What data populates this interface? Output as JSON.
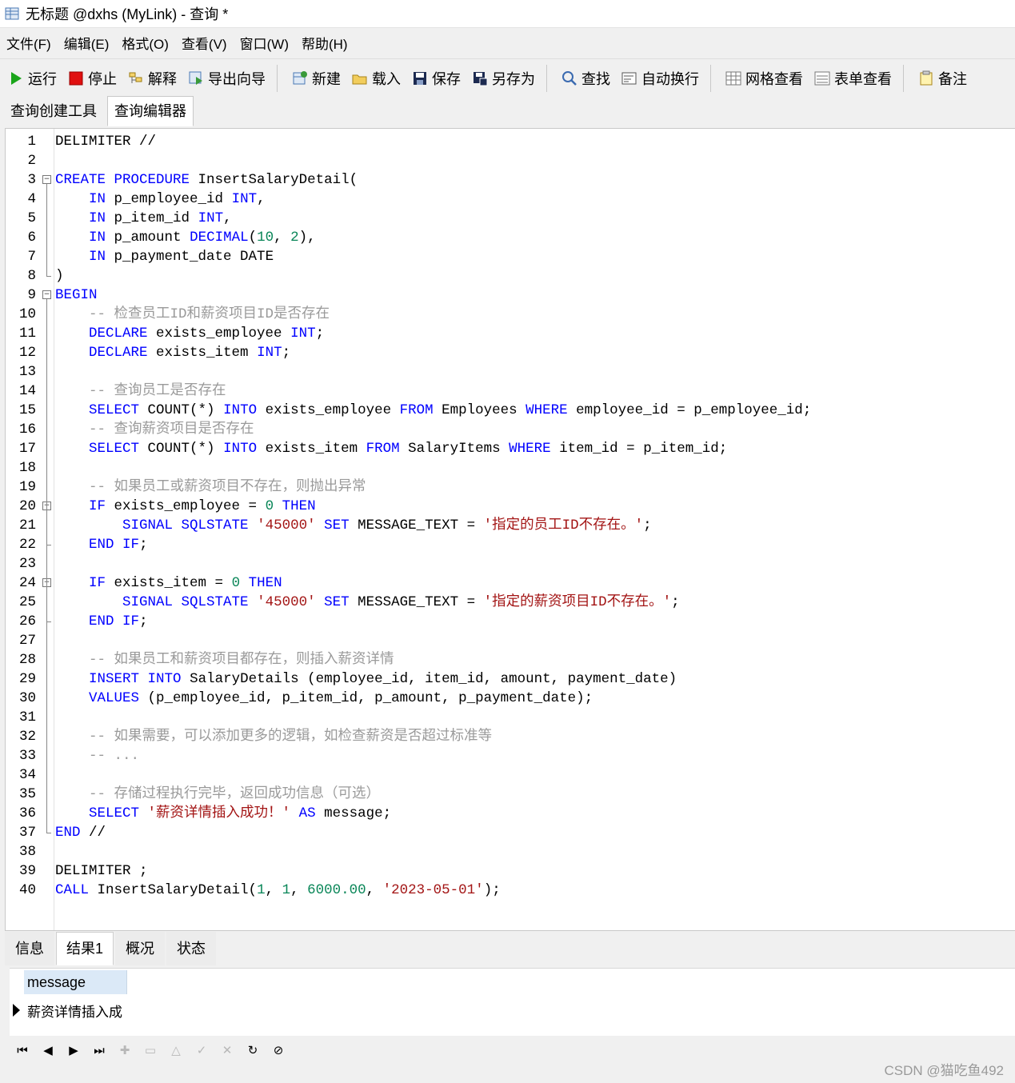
{
  "window": {
    "title": "无标题 @dxhs (MyLink) - 查询 *"
  },
  "menu": [
    "文件(F)",
    "编辑(E)",
    "格式(O)",
    "查看(V)",
    "窗口(W)",
    "帮助(H)"
  ],
  "toolbar": [
    {
      "label": "运行",
      "icon": "run-icon"
    },
    {
      "label": "停止",
      "icon": "stop-icon"
    },
    {
      "label": "解释",
      "icon": "explain-icon"
    },
    {
      "label": "导出向导",
      "icon": "export-wizard-icon"
    },
    {
      "label": "新建",
      "icon": "new-icon"
    },
    {
      "label": "载入",
      "icon": "load-icon"
    },
    {
      "label": "保存",
      "icon": "save-icon"
    },
    {
      "label": "另存为",
      "icon": "save-as-icon"
    },
    {
      "label": "查找",
      "icon": "find-icon"
    },
    {
      "label": "自动换行",
      "icon": "word-wrap-icon"
    },
    {
      "label": "网格查看",
      "icon": "grid-view-icon"
    },
    {
      "label": "表单查看",
      "icon": "form-view-icon"
    },
    {
      "label": "备注",
      "icon": "note-icon"
    }
  ],
  "doc_tabs": [
    "查询创建工具",
    "查询编辑器"
  ],
  "active_doc_tab": "查询编辑器",
  "code_lines": [
    [
      {
        "t": "DELIMITER //",
        "c": "id"
      }
    ],
    [],
    [
      {
        "t": "CREATE",
        "c": "kw"
      },
      {
        "t": " ",
        "c": "id"
      },
      {
        "t": "PROCEDURE",
        "c": "kw"
      },
      {
        "t": " InsertSalaryDetail(",
        "c": "id"
      }
    ],
    [
      {
        "t": "    ",
        "c": "id"
      },
      {
        "t": "IN",
        "c": "kw"
      },
      {
        "t": " p_employee_id ",
        "c": "id"
      },
      {
        "t": "INT",
        "c": "kw"
      },
      {
        "t": ",",
        "c": "id"
      }
    ],
    [
      {
        "t": "    ",
        "c": "id"
      },
      {
        "t": "IN",
        "c": "kw"
      },
      {
        "t": " p_item_id ",
        "c": "id"
      },
      {
        "t": "INT",
        "c": "kw"
      },
      {
        "t": ",",
        "c": "id"
      }
    ],
    [
      {
        "t": "    ",
        "c": "id"
      },
      {
        "t": "IN",
        "c": "kw"
      },
      {
        "t": " p_amount ",
        "c": "id"
      },
      {
        "t": "DECIMAL",
        "c": "kw"
      },
      {
        "t": "(",
        "c": "id"
      },
      {
        "t": "10",
        "c": "num"
      },
      {
        "t": ", ",
        "c": "id"
      },
      {
        "t": "2",
        "c": "num"
      },
      {
        "t": "),",
        "c": "id"
      }
    ],
    [
      {
        "t": "    ",
        "c": "id"
      },
      {
        "t": "IN",
        "c": "kw"
      },
      {
        "t": " p_payment_date DATE",
        "c": "id"
      }
    ],
    [
      {
        "t": ")",
        "c": "id"
      }
    ],
    [
      {
        "t": "BEGIN",
        "c": "kw"
      }
    ],
    [
      {
        "t": "    -- 检查员工ID和薪资项目ID是否存在",
        "c": "cm"
      }
    ],
    [
      {
        "t": "    ",
        "c": "id"
      },
      {
        "t": "DECLARE",
        "c": "kw"
      },
      {
        "t": " exists_employee ",
        "c": "id"
      },
      {
        "t": "INT",
        "c": "kw"
      },
      {
        "t": ";",
        "c": "id"
      }
    ],
    [
      {
        "t": "    ",
        "c": "id"
      },
      {
        "t": "DECLARE",
        "c": "kw"
      },
      {
        "t": " exists_item ",
        "c": "id"
      },
      {
        "t": "INT",
        "c": "kw"
      },
      {
        "t": ";",
        "c": "id"
      }
    ],
    [],
    [
      {
        "t": "    -- 查询员工是否存在",
        "c": "cm"
      }
    ],
    [
      {
        "t": "    ",
        "c": "id"
      },
      {
        "t": "SELECT",
        "c": "kw"
      },
      {
        "t": " COUNT(*) ",
        "c": "id"
      },
      {
        "t": "INTO",
        "c": "kw"
      },
      {
        "t": " exists_employee ",
        "c": "id"
      },
      {
        "t": "FROM",
        "c": "kw"
      },
      {
        "t": " Employees ",
        "c": "id"
      },
      {
        "t": "WHERE",
        "c": "kw"
      },
      {
        "t": " employee_id = p_employee_id;",
        "c": "id"
      }
    ],
    [
      {
        "t": "    -- 查询薪资项目是否存在",
        "c": "cm"
      }
    ],
    [
      {
        "t": "    ",
        "c": "id"
      },
      {
        "t": "SELECT",
        "c": "kw"
      },
      {
        "t": " COUNT(*) ",
        "c": "id"
      },
      {
        "t": "INTO",
        "c": "kw"
      },
      {
        "t": " exists_item ",
        "c": "id"
      },
      {
        "t": "FROM",
        "c": "kw"
      },
      {
        "t": " SalaryItems ",
        "c": "id"
      },
      {
        "t": "WHERE",
        "c": "kw"
      },
      {
        "t": " item_id = p_item_id;",
        "c": "id"
      }
    ],
    [],
    [
      {
        "t": "    -- 如果员工或薪资项目不存在，则抛出异常",
        "c": "cm"
      }
    ],
    [
      {
        "t": "    ",
        "c": "id"
      },
      {
        "t": "IF",
        "c": "kw"
      },
      {
        "t": " exists_employee = ",
        "c": "id"
      },
      {
        "t": "0",
        "c": "num"
      },
      {
        "t": " ",
        "c": "id"
      },
      {
        "t": "THEN",
        "c": "kw"
      }
    ],
    [
      {
        "t": "        ",
        "c": "id"
      },
      {
        "t": "SIGNAL",
        "c": "kw"
      },
      {
        "t": " ",
        "c": "id"
      },
      {
        "t": "SQLSTATE",
        "c": "kw"
      },
      {
        "t": " ",
        "c": "id"
      },
      {
        "t": "'45000'",
        "c": "str"
      },
      {
        "t": " ",
        "c": "id"
      },
      {
        "t": "SET",
        "c": "kw"
      },
      {
        "t": " MESSAGE_TEXT = ",
        "c": "id"
      },
      {
        "t": "'指定的员工ID不存在。'",
        "c": "str"
      },
      {
        "t": ";",
        "c": "id"
      }
    ],
    [
      {
        "t": "    ",
        "c": "id"
      },
      {
        "t": "END",
        "c": "kw"
      },
      {
        "t": " ",
        "c": "id"
      },
      {
        "t": "IF",
        "c": "kw"
      },
      {
        "t": ";",
        "c": "id"
      }
    ],
    [],
    [
      {
        "t": "    ",
        "c": "id"
      },
      {
        "t": "IF",
        "c": "kw"
      },
      {
        "t": " exists_item = ",
        "c": "id"
      },
      {
        "t": "0",
        "c": "num"
      },
      {
        "t": " ",
        "c": "id"
      },
      {
        "t": "THEN",
        "c": "kw"
      }
    ],
    [
      {
        "t": "        ",
        "c": "id"
      },
      {
        "t": "SIGNAL",
        "c": "kw"
      },
      {
        "t": " ",
        "c": "id"
      },
      {
        "t": "SQLSTATE",
        "c": "kw"
      },
      {
        "t": " ",
        "c": "id"
      },
      {
        "t": "'45000'",
        "c": "str"
      },
      {
        "t": " ",
        "c": "id"
      },
      {
        "t": "SET",
        "c": "kw"
      },
      {
        "t": " MESSAGE_TEXT = ",
        "c": "id"
      },
      {
        "t": "'指定的薪资项目ID不存在。'",
        "c": "str"
      },
      {
        "t": ";",
        "c": "id"
      }
    ],
    [
      {
        "t": "    ",
        "c": "id"
      },
      {
        "t": "END",
        "c": "kw"
      },
      {
        "t": " ",
        "c": "id"
      },
      {
        "t": "IF",
        "c": "kw"
      },
      {
        "t": ";",
        "c": "id"
      }
    ],
    [],
    [
      {
        "t": "    -- 如果员工和薪资项目都存在，则插入薪资详情",
        "c": "cm"
      }
    ],
    [
      {
        "t": "    ",
        "c": "id"
      },
      {
        "t": "INSERT",
        "c": "kw"
      },
      {
        "t": " ",
        "c": "id"
      },
      {
        "t": "INTO",
        "c": "kw"
      },
      {
        "t": " SalaryDetails (employee_id, item_id, amount, payment_date)",
        "c": "id"
      }
    ],
    [
      {
        "t": "    ",
        "c": "id"
      },
      {
        "t": "VALUES",
        "c": "kw"
      },
      {
        "t": " (p_employee_id, p_item_id, p_amount, p_payment_date);",
        "c": "id"
      }
    ],
    [],
    [
      {
        "t": "    -- 如果需要，可以添加更多的逻辑，如检查薪资是否超过标准等",
        "c": "cm"
      }
    ],
    [
      {
        "t": "    -- ...",
        "c": "cm"
      }
    ],
    [],
    [
      {
        "t": "    -- 存储过程执行完毕，返回成功信息（可选）",
        "c": "cm"
      }
    ],
    [
      {
        "t": "    ",
        "c": "id"
      },
      {
        "t": "SELECT",
        "c": "kw"
      },
      {
        "t": " ",
        "c": "id"
      },
      {
        "t": "'薪资详情插入成功！'",
        "c": "str"
      },
      {
        "t": " ",
        "c": "id"
      },
      {
        "t": "AS",
        "c": "kw"
      },
      {
        "t": " message;",
        "c": "id"
      }
    ],
    [
      {
        "t": "END",
        "c": "kw"
      },
      {
        "t": " //",
        "c": "id"
      }
    ],
    [],
    [
      {
        "t": "DELIMITER ;",
        "c": "id"
      }
    ],
    [
      {
        "t": "CALL",
        "c": "kw"
      },
      {
        "t": " InsertSalaryDetail(",
        "c": "id"
      },
      {
        "t": "1",
        "c": "num"
      },
      {
        "t": ", ",
        "c": "id"
      },
      {
        "t": "1",
        "c": "num"
      },
      {
        "t": ", ",
        "c": "id"
      },
      {
        "t": "6000.00",
        "c": "num"
      },
      {
        "t": ", ",
        "c": "id"
      },
      {
        "t": "'2023-05-01'",
        "c": "str"
      },
      {
        "t": ");",
        "c": "id"
      }
    ]
  ],
  "fold_markers": {
    "3": "start",
    "8": "end",
    "9": "start",
    "20": "start",
    "22": "end",
    "24": "start",
    "26": "end",
    "37": "end"
  },
  "result_tabs": [
    "信息",
    "结果1",
    "概况",
    "状态"
  ],
  "active_result_tab": "结果1",
  "result_grid": {
    "columns": [
      "message"
    ],
    "rows": [
      [
        "薪资详情插入成"
      ]
    ]
  },
  "nav_buttons": [
    {
      "name": "first-record-icon",
      "glyph": "⏮",
      "enabled": true
    },
    {
      "name": "prev-record-icon",
      "glyph": "◀",
      "enabled": true
    },
    {
      "name": "next-record-icon",
      "glyph": "▶",
      "enabled": true
    },
    {
      "name": "last-record-icon",
      "glyph": "⏭",
      "enabled": true
    },
    {
      "name": "add-record-icon",
      "glyph": "✚",
      "enabled": false
    },
    {
      "name": "delete-record-icon",
      "glyph": "▭",
      "enabled": false
    },
    {
      "name": "edit-record-icon",
      "glyph": "△",
      "enabled": false
    },
    {
      "name": "apply-icon",
      "glyph": "✓",
      "enabled": false
    },
    {
      "name": "cancel-icon",
      "glyph": "✕",
      "enabled": false
    },
    {
      "name": "refresh-icon",
      "glyph": "↻",
      "enabled": true
    },
    {
      "name": "stop-icon",
      "glyph": "⊘",
      "enabled": true
    }
  ],
  "watermark": "CSDN @猫吃鱼492",
  "colors": {
    "keyword": "#0000ff",
    "number": "#098658",
    "string": "#a31515",
    "comment": "#9a9a9a",
    "run": "#1aa51a",
    "stop": "#e01010"
  }
}
